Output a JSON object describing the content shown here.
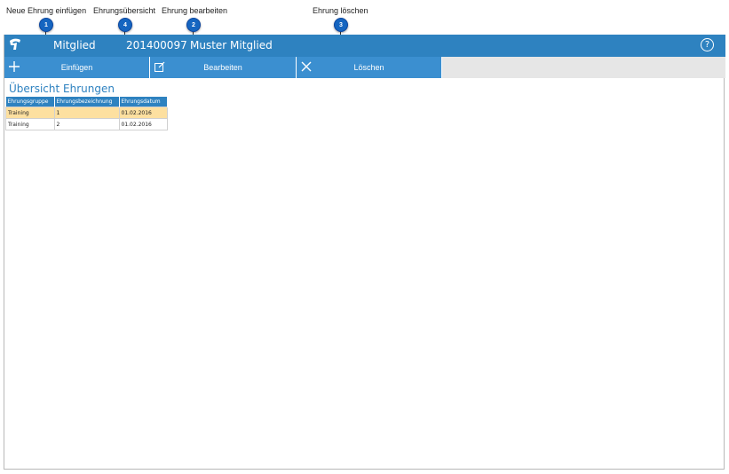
{
  "callouts": [
    {
      "number": "1",
      "label": "Neue Ehrung einfügen"
    },
    {
      "number": "4",
      "label": "Ehrungsübersicht"
    },
    {
      "number": "2",
      "label": "Ehrung bearbeiten"
    },
    {
      "number": "3",
      "label": "Ehrung löschen"
    }
  ],
  "header": {
    "section_label": "Mitglied",
    "member_id": "201400097",
    "member_name": "Muster Mitglied",
    "help_symbol": "?",
    "logo_icon": "app-logo-icon"
  },
  "toolbar": {
    "add_label": "Einfügen",
    "edit_label": "Bearbeiten",
    "delete_label": "Löschen",
    "add_icon": "plus-icon",
    "edit_icon": "edit-icon",
    "delete_icon": "close-icon"
  },
  "page": {
    "title": "Übersicht Ehrungen"
  },
  "table": {
    "columns": [
      "Ehrungsgruppe",
      "Ehrungsbezeichnung",
      "Ehrungsdatum"
    ],
    "rows": [
      {
        "group": "Training",
        "name": "1",
        "date": "01.02.2016",
        "selected": true
      },
      {
        "group": "Training",
        "name": "2",
        "date": "01.02.2016",
        "selected": false
      }
    ]
  },
  "colors": {
    "header_bg": "#2e82c0",
    "toolbar_button_bg": "#3b8fd0",
    "selected_row_bg": "#fde0a0",
    "marker_bg": "#1565c0"
  }
}
